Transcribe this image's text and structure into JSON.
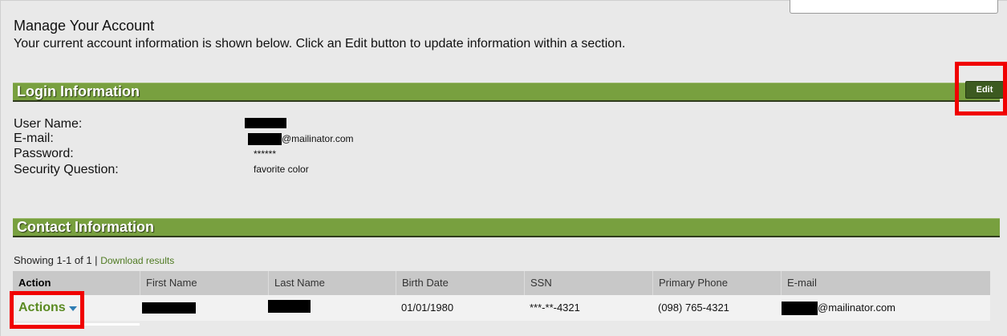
{
  "header": {
    "title": "Manage Your Account",
    "description": "Your current account information is shown below. Click an Edit button to update information within a section."
  },
  "login_section": {
    "title": "Login Information",
    "edit_label": "Edit",
    "fields": [
      {
        "label": "User Name:",
        "value": ""
      },
      {
        "label": "E-mail:",
        "value": "@mailinator.com"
      },
      {
        "label": "Password:",
        "value": "******"
      },
      {
        "label": "Security Question:",
        "value": "favorite color"
      }
    ]
  },
  "contact_section": {
    "title": "Contact Information",
    "showing_text": "Showing 1-1 of 1 |",
    "download_link": "Download results",
    "columns": [
      "Action",
      "First Name",
      "Last Name",
      "Birth Date",
      "SSN",
      "Primary Phone",
      "E-mail"
    ],
    "rows": [
      {
        "action": "Actions",
        "first_name": "",
        "last_name": "",
        "birth_date": "01/01/1980",
        "ssn": "***-**-4321",
        "phone": "(098) 765-4321",
        "email": "@mailinator.com"
      }
    ]
  },
  "colors": {
    "section_green": "#78a03f",
    "edit_button": "#3c5a20",
    "highlight_red": "#f00000",
    "link_green": "#5a8a22"
  },
  "icons": {
    "actions_caret": "chevron-down-icon"
  }
}
